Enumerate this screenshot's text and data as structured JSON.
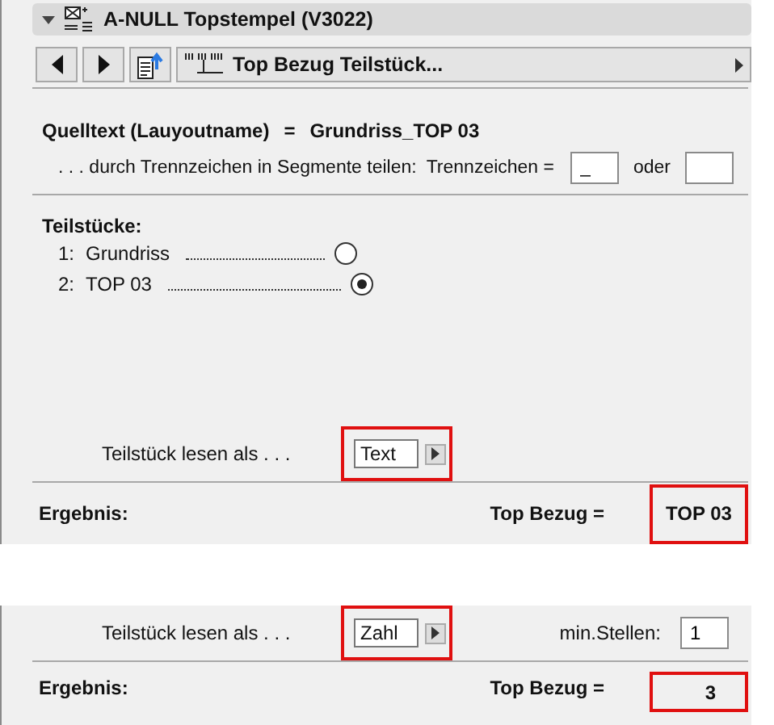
{
  "panel": {
    "title": "A-NULL Topstempel (V3022)",
    "expanded": true
  },
  "toolbar": {
    "selector_label": "Top Bezug Teilstück..."
  },
  "source": {
    "label": "Quelltext (Lauyoutname)",
    "equals": "=",
    "value": "Grundriss_TOP 03"
  },
  "split": {
    "label": ". . . durch Trennzeichen in Segmente teilen:",
    "separator_label": "Trennzeichen =",
    "separator_value": "_",
    "or_label": "oder"
  },
  "segments": {
    "title": "Teilstücke:",
    "items": [
      {
        "index": "1:",
        "name": "Grundriss",
        "selected": false
      },
      {
        "index": "2:",
        "name": "TOP 03",
        "selected": true
      }
    ]
  },
  "views": [
    {
      "kind": "text",
      "read_label": "Teilstück lesen als . . .",
      "read_as": "Text",
      "result_label": "Ergebnis:",
      "reference_label": "Top Bezug =",
      "result": "TOP 03"
    },
    {
      "kind": "number",
      "read_label": "Teilstück lesen als . . .",
      "read_as": "Zahl",
      "min_digits_label": "min.Stellen:",
      "min_digits": "1",
      "result_label": "Ergebnis:",
      "reference_label": "Top Bezug =",
      "result": "3"
    }
  ]
}
